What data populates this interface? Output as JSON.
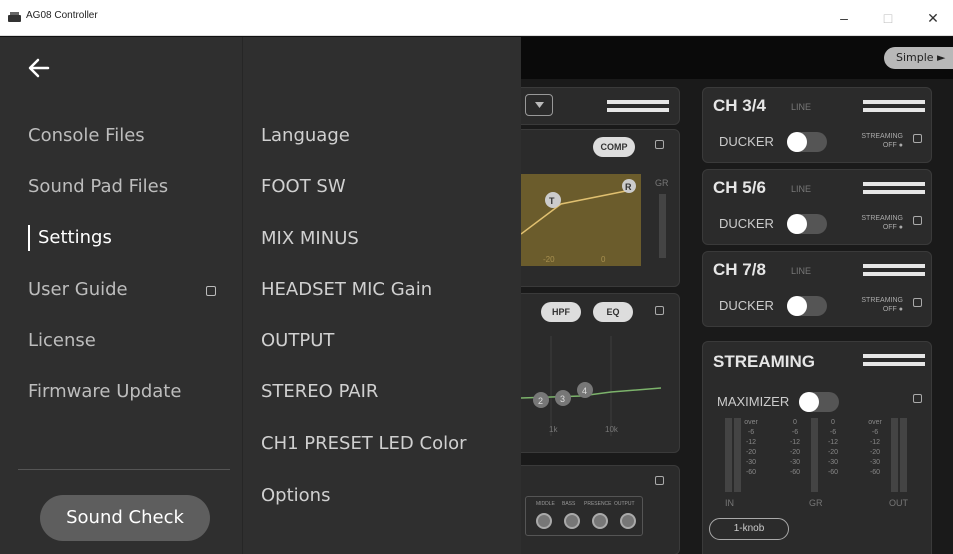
{
  "window": {
    "title": "AG08 Controller",
    "minimize": "–",
    "maximize": "□",
    "close": "✕"
  },
  "background": {
    "simple_button": "Simple ►",
    "comp": "COMP",
    "hpf": "HPF",
    "eq": "EQ",
    "in_out": "IN\nOUT",
    "gr": "GR",
    "graph_marks": [
      "T",
      "R"
    ],
    "graph_ticks": [
      "-20",
      "0"
    ],
    "eq_bands": [
      "2",
      "3",
      "4"
    ],
    "eq_freqs": [
      "1k",
      "10k"
    ],
    "knob_labels": [
      "MIDDLE",
      "BASS",
      "PRESENCE",
      "OUTPUT"
    ],
    "channels": [
      {
        "label": "CH 3/4",
        "type": "LINE"
      },
      {
        "label": "CH 5/6",
        "type": "LINE"
      },
      {
        "label": "CH 7/8",
        "type": "LINE"
      }
    ],
    "ducker_label": "DUCKER",
    "streaming_small": "STREAMING\nOFF ●",
    "streaming_title": "STREAMING",
    "maximizer": "MAXIMIZER",
    "meter_scale": [
      "over",
      "-6",
      "-12",
      "-20",
      "-30",
      "-60"
    ],
    "gr_scale": [
      "0",
      "-6",
      "-12",
      "-20",
      "-30",
      "-60"
    ],
    "meter_in": "IN",
    "meter_gr": "GR",
    "meter_out": "OUT",
    "one_knob": "1-knob"
  },
  "nav": {
    "items": [
      {
        "label": "Console Files"
      },
      {
        "label": "Sound Pad Files"
      },
      {
        "label": "Settings"
      },
      {
        "label": "User Guide"
      },
      {
        "label": "License"
      },
      {
        "label": "Firmware Update"
      }
    ],
    "sound_check": "Sound Check"
  },
  "settings": {
    "items": [
      {
        "label": "Language"
      },
      {
        "label": "FOOT SW"
      },
      {
        "label": "MIX MINUS"
      },
      {
        "label": "HEADSET MIC Gain"
      },
      {
        "label": "OUTPUT"
      },
      {
        "label": "STEREO PAIR"
      },
      {
        "label": "CH1 PRESET LED Color"
      },
      {
        "label": "Options"
      }
    ]
  }
}
